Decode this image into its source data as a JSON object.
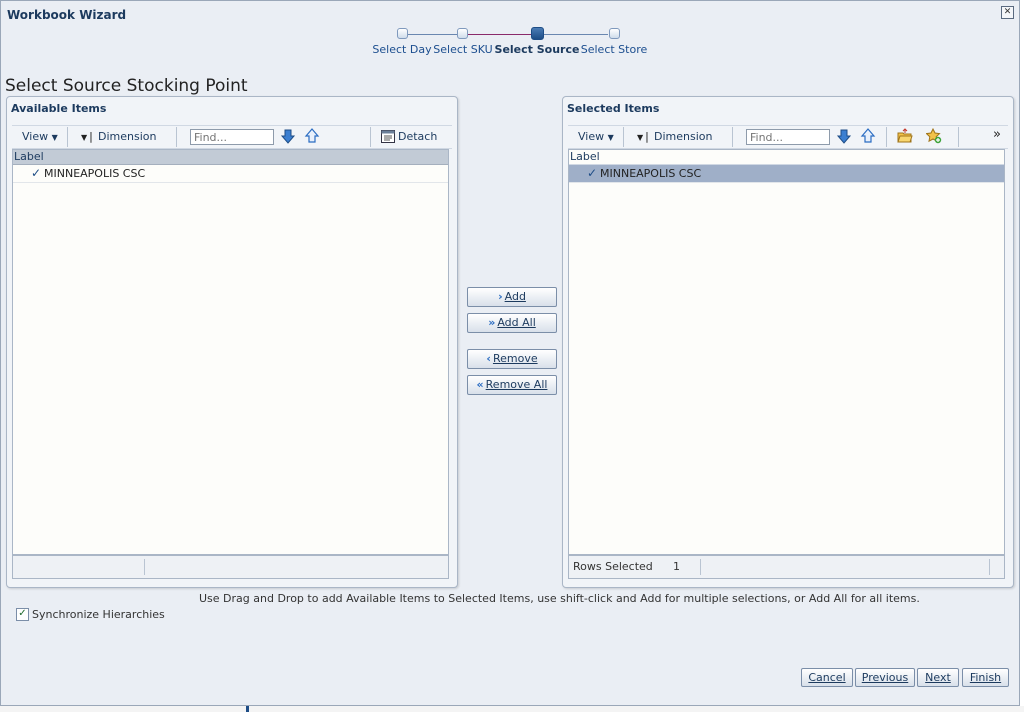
{
  "dialog": {
    "title": "Workbook Wizard",
    "close_glyph": "✕"
  },
  "train": {
    "steps": [
      {
        "label": "Select Day"
      },
      {
        "label": "Select SKU"
      },
      {
        "label": "Select Source"
      },
      {
        "label": "Select Store"
      }
    ],
    "active_step": "Select Source"
  },
  "page": {
    "title": "Select Source Stocking Point"
  },
  "available": {
    "title": "Available Items",
    "view_label": "View",
    "dimension_label": "Dimension",
    "find_placeholder": "Find...",
    "detach_label": "Detach",
    "column_header": "Label",
    "rows": [
      {
        "label": "MINNEAPOLIS CSC"
      }
    ]
  },
  "selected": {
    "title": "Selected Items",
    "view_label": "View",
    "dimension_label": "Dimension",
    "find_placeholder": "Find...",
    "overflow_glyph": "»",
    "column_header": "Label",
    "rows": [
      {
        "label": "MINNEAPOLIS CSC"
      }
    ],
    "rows_selected_label": "Rows Selected",
    "rows_selected_count": "1"
  },
  "shuttle": {
    "add": "Add",
    "add_all": "Add All",
    "remove": "Remove",
    "remove_all": "Remove All"
  },
  "instructions": "Use Drag and Drop to add Available Items to Selected Items, use shift-click and Add for multiple selections, or Add All for all items.",
  "sync": {
    "label": "Synchronize Hierarchies",
    "checked": true
  },
  "buttons": {
    "cancel": "Cancel",
    "previous": "Previous",
    "next": "Next",
    "finish": "Finish"
  },
  "colors": {
    "accent": "#1c3a5e",
    "selection": "#9fafc8",
    "arrow": "#2a6cc2"
  }
}
